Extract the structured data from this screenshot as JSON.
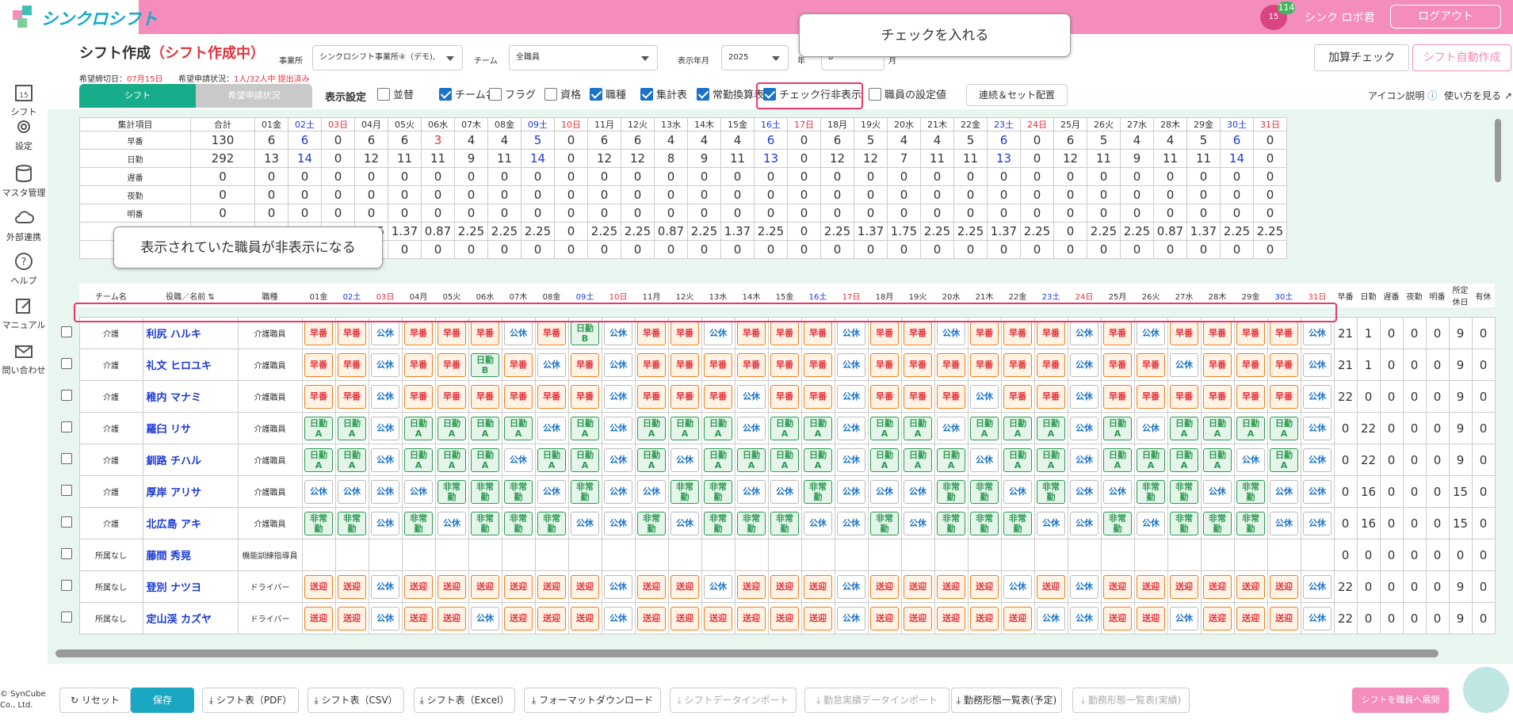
{
  "app": {
    "name": "シンクロシフト",
    "user": "シンク ロボ君",
    "logout": "ログアウト",
    "notify_count": "114",
    "cal_day": "15"
  },
  "sidebar": [
    {
      "label": "シフト",
      "icon": "calendar-icon"
    },
    {
      "label": "設定",
      "icon": "gear-icon"
    },
    {
      "label": "マスタ管理",
      "icon": "database-icon"
    },
    {
      "label": "外部連携",
      "icon": "cloud-icon"
    },
    {
      "label": "ヘルプ",
      "icon": "help-icon"
    },
    {
      "label": "マニュアル",
      "icon": "edit-icon"
    },
    {
      "label": "問い合わせ",
      "icon": "mail-icon"
    }
  ],
  "header": {
    "title": "シフト作成",
    "status": "（シフト作成中）",
    "office_label": "事業所",
    "office_value": "シンクロシフト事業所④（デモ),",
    "team_label": "チーム",
    "team_value": "全職員",
    "month_label": "表示年月",
    "year_value": "2025",
    "year_unit": "年",
    "month_value": "8",
    "month_unit": "月",
    "deadline_label": "希望締切日：",
    "deadline_value": "07月15日",
    "wish_label": "希望申請状況：",
    "wish_value": "1人/32人中 提出済み"
  },
  "tabs": {
    "shift": "シフト",
    "wish": "希望申請状況"
  },
  "display": {
    "label": "表示設定",
    "options": [
      {
        "label": "並替",
        "checked": false
      },
      {
        "label": "チーム名",
        "checked": true
      },
      {
        "label": "フラグ",
        "checked": false
      },
      {
        "label": "資格",
        "checked": false
      },
      {
        "label": "職種",
        "checked": true
      },
      {
        "label": "集計表",
        "checked": true
      },
      {
        "label": "常勤換算表",
        "checked": true
      },
      {
        "label": "チェック行非表示",
        "checked": true
      },
      {
        "label": "職員の設定値",
        "checked": false
      }
    ],
    "set_button": "連続＆セット配置"
  },
  "right_buttons": {
    "kasan": "加算チェック",
    "auto": "シフト自動作成",
    "icon_help": "アイコン説明",
    "howto": "使い方を見る"
  },
  "callouts": {
    "top": "チェックを入れる",
    "mid": "表示されていた職員が非表示になる"
  },
  "days": [
    "01金",
    "02土",
    "03日",
    "04月",
    "05火",
    "06水",
    "07木",
    "08金",
    "09土",
    "10日",
    "11月",
    "12火",
    "13水",
    "14木",
    "15金",
    "16土",
    "17日",
    "18月",
    "19火",
    "20水",
    "21木",
    "22金",
    "23土",
    "24日",
    "25月",
    "26火",
    "27水",
    "28木",
    "29金",
    "30土",
    "31日"
  ],
  "summary": {
    "col_item": "集計項目",
    "col_total": "合計",
    "rows": [
      {
        "name": "早番",
        "total": "130",
        "vals": [
          "6",
          "6",
          "0",
          "6",
          "6",
          "3",
          "4",
          "4",
          "5",
          "0",
          "6",
          "6",
          "4",
          "4",
          "4",
          "6",
          "0",
          "6",
          "5",
          "4",
          "4",
          "5",
          "6",
          "0",
          "6",
          "5",
          "4",
          "4",
          "5",
          "6",
          "0"
        ]
      },
      {
        "name": "日勤",
        "total": "292",
        "vals": [
          "13",
          "14",
          "0",
          "12",
          "11",
          "11",
          "9",
          "11",
          "14",
          "0",
          "12",
          "12",
          "8",
          "9",
          "11",
          "13",
          "0",
          "12",
          "12",
          "7",
          "11",
          "11",
          "13",
          "0",
          "12",
          "11",
          "9",
          "11",
          "11",
          "14",
          "0"
        ]
      },
      {
        "name": "遅番",
        "total": "0",
        "vals": [
          "0",
          "0",
          "0",
          "0",
          "0",
          "0",
          "0",
          "0",
          "0",
          "0",
          "0",
          "0",
          "0",
          "0",
          "0",
          "0",
          "0",
          "0",
          "0",
          "0",
          "0",
          "0",
          "0",
          "0",
          "0",
          "0",
          "0",
          "0",
          "0",
          "0",
          "0"
        ]
      },
      {
        "name": "夜勤",
        "total": "0",
        "vals": [
          "0",
          "0",
          "0",
          "0",
          "0",
          "0",
          "0",
          "0",
          "0",
          "0",
          "0",
          "0",
          "0",
          "0",
          "0",
          "0",
          "0",
          "0",
          "0",
          "0",
          "0",
          "0",
          "0",
          "0",
          "0",
          "0",
          "0",
          "0",
          "0",
          "0",
          "0"
        ]
      },
      {
        "name": "明番",
        "total": "0",
        "vals": [
          "0",
          "0",
          "0",
          "0",
          "0",
          "0",
          "0",
          "0",
          "0",
          "0",
          "0",
          "0",
          "0",
          "0",
          "0",
          "0",
          "0",
          "0",
          "0",
          "0",
          "0",
          "0",
          "0",
          "0",
          "0",
          "0",
          "0",
          "0",
          "0",
          "0",
          "0"
        ]
      },
      {
        "name": "",
        "total": "",
        "vals": [
          "0",
          "0",
          "0",
          "2.25",
          "1.37",
          "0.87",
          "2.25",
          "2.25",
          "2.25",
          "0",
          "2.25",
          "2.25",
          "0.87",
          "2.25",
          "1.37",
          "2.25",
          "0",
          "2.25",
          "1.37",
          "1.75",
          "2.25",
          "2.25",
          "1.37",
          "2.25",
          "0",
          "2.25",
          "2.25",
          "0.87",
          "1.37",
          "2.25",
          "2.25",
          "0"
        ]
      },
      {
        "name": "",
        "total": "",
        "vals": [
          "0",
          "0",
          "0",
          "0",
          "0",
          "0",
          "0",
          "0",
          "0",
          "0",
          "0",
          "0",
          "0",
          "0",
          "0",
          "0",
          "0",
          "0",
          "0",
          "0",
          "0",
          "0",
          "0",
          "0",
          "0",
          "0",
          "0",
          "0",
          "0",
          "0",
          "0"
        ]
      }
    ]
  },
  "staff_header": {
    "team": "チーム名",
    "name": "役職／名前",
    "job": "職種",
    "sums": [
      "早番",
      "日勤",
      "遅番",
      "夜勤",
      "明番",
      "所定休日",
      "有休"
    ]
  },
  "staff": [
    {
      "team": "介護",
      "name": "利尻 ハルキ",
      "job": "介護職員",
      "shifts": [
        "e",
        "e",
        "k",
        "e",
        "e",
        "e",
        "k",
        "e",
        "B",
        "k",
        "e",
        "e",
        "k",
        "e",
        "e",
        "e",
        "k",
        "e",
        "e",
        "k",
        "e",
        "e",
        "e",
        "k",
        "e",
        "k",
        "e",
        "e",
        "e",
        "e",
        "k"
      ],
      "sums": [
        "21",
        "1",
        "0",
        "0",
        "0",
        "9",
        "0"
      ]
    },
    {
      "team": "介護",
      "name": "礼文 ヒロユキ",
      "job": "介護職員",
      "shifts": [
        "e",
        "e",
        "k",
        "e",
        "e",
        "B",
        "e",
        "k",
        "e",
        "k",
        "e",
        "e",
        "e",
        "e",
        "e",
        "e",
        "k",
        "e",
        "e",
        "e",
        "e",
        "e",
        "e",
        "k",
        "e",
        "e",
        "k",
        "e",
        "e",
        "e",
        "k"
      ],
      "sums": [
        "21",
        "1",
        "0",
        "0",
        "0",
        "9",
        "0"
      ]
    },
    {
      "team": "介護",
      "name": "稚内 マナミ",
      "job": "介護職員",
      "shifts": [
        "e",
        "e",
        "k",
        "e",
        "e",
        "e",
        "e",
        "e",
        "e",
        "k",
        "e",
        "e",
        "e",
        "k",
        "e",
        "e",
        "k",
        "e",
        "e",
        "e",
        "k",
        "e",
        "e",
        "k",
        "e",
        "e",
        "e",
        "e",
        "e",
        "e",
        "k"
      ],
      "sums": [
        "22",
        "0",
        "0",
        "0",
        "0",
        "9",
        "0"
      ]
    },
    {
      "team": "介護",
      "name": "羅臼 リサ",
      "job": "介護職員",
      "shifts": [
        "d",
        "d",
        "k",
        "d",
        "d",
        "d",
        "d",
        "k",
        "d",
        "k",
        "d",
        "d",
        "d",
        "k",
        "d",
        "d",
        "k",
        "d",
        "d",
        "k",
        "d",
        "d",
        "d",
        "k",
        "d",
        "k",
        "d",
        "d",
        "d",
        "d",
        "k"
      ],
      "sums": [
        "0",
        "22",
        "0",
        "0",
        "0",
        "9",
        "0"
      ]
    },
    {
      "team": "介護",
      "name": "釧路 チハル",
      "job": "介護職員",
      "shifts": [
        "d",
        "d",
        "k",
        "d",
        "d",
        "d",
        "k",
        "d",
        "d",
        "k",
        "d",
        "k",
        "d",
        "d",
        "d",
        "d",
        "k",
        "d",
        "d",
        "d",
        "k",
        "d",
        "d",
        "k",
        "d",
        "d",
        "d",
        "d",
        "k",
        "d",
        "k"
      ],
      "sums": [
        "0",
        "22",
        "0",
        "0",
        "0",
        "9",
        "0"
      ]
    },
    {
      "team": "介護",
      "name": "厚岸 アリサ",
      "job": "介護職員",
      "shifts": [
        "k",
        "k",
        "k",
        "k",
        "n",
        "n",
        "n",
        "k",
        "n",
        "k",
        "k",
        "n",
        "n",
        "k",
        "k",
        "n",
        "k",
        "k",
        "k",
        "n",
        "n",
        "k",
        "n",
        "k",
        "k",
        "n",
        "n",
        "k",
        "n",
        "k",
        "k"
      ],
      "sums": [
        "0",
        "16",
        "0",
        "0",
        "0",
        "15",
        "0"
      ]
    },
    {
      "team": "介護",
      "name": "北広島 アキ",
      "job": "介護職員",
      "shifts": [
        "n",
        "n",
        "k",
        "n",
        "k",
        "n",
        "n",
        "n",
        "k",
        "k",
        "n",
        "k",
        "n",
        "n",
        "n",
        "k",
        "k",
        "n",
        "k",
        "n",
        "n",
        "n",
        "k",
        "k",
        "n",
        "k",
        "n",
        "n",
        "n",
        "k",
        "k"
      ],
      "sums": [
        "0",
        "16",
        "0",
        "0",
        "0",
        "15",
        "0"
      ]
    },
    {
      "team": "所属なし",
      "name": "藤間 秀晃",
      "job": "機能訓練指導員",
      "shifts": [
        "",
        "",
        "",
        "",
        "",
        "",
        "",
        "",
        "",
        "",
        "",
        "",
        "",
        "",
        "",
        "",
        "",
        "",
        "",
        "",
        "",
        "",
        "",
        "",
        "",
        "",
        "",
        "",
        "",
        "",
        ""
      ],
      "sums": [
        "0",
        "0",
        "0",
        "0",
        "0",
        "0",
        "0"
      ]
    },
    {
      "team": "所属なし",
      "name": "登別 ナツヨ",
      "job": "ドライバー",
      "shifts": [
        "s",
        "s",
        "k",
        "s",
        "s",
        "s",
        "s",
        "s",
        "s",
        "k",
        "s",
        "s",
        "k",
        "s",
        "s",
        "s",
        "k",
        "s",
        "s",
        "s",
        "s",
        "k",
        "s",
        "k",
        "s",
        "s",
        "s",
        "s",
        "s",
        "s",
        "k"
      ],
      "sums": [
        "22",
        "0",
        "0",
        "0",
        "0",
        "9",
        "0"
      ]
    },
    {
      "team": "所属なし",
      "name": "定山渓 カズヤ",
      "job": "ドライバー",
      "shifts": [
        "s",
        "s",
        "k",
        "s",
        "s",
        "k",
        "s",
        "s",
        "s",
        "k",
        "s",
        "s",
        "s",
        "s",
        "s",
        "s",
        "k",
        "s",
        "s",
        "s",
        "s",
        "s",
        "k",
        "k",
        "s",
        "s",
        "k",
        "s",
        "s",
        "s",
        "k"
      ],
      "sums": [
        "22",
        "0",
        "0",
        "0",
        "0",
        "9",
        "0"
      ]
    }
  ],
  "shift_labels": {
    "e": "早番",
    "k": "公休",
    "s": "送迎",
    "d1": "日勤",
    "d2": "A",
    "b1": "日勤",
    "b2": "B",
    "n1": "非常",
    "n2": "勤"
  },
  "bottom": {
    "copyright": "© SynCube Co., Ltd.",
    "buttons": [
      "リセット",
      "保存",
      "シフト表（PDF）",
      "シフト表（CSV）",
      "シフト表（Excel）",
      "フォーマットダウンロード",
      "シフトデータインポート",
      "勤怠実績データインポート",
      "勤務形態一覧表(予定)",
      "勤務形態一覧表(実績)"
    ],
    "publish": "シフトを職員へ展開"
  }
}
